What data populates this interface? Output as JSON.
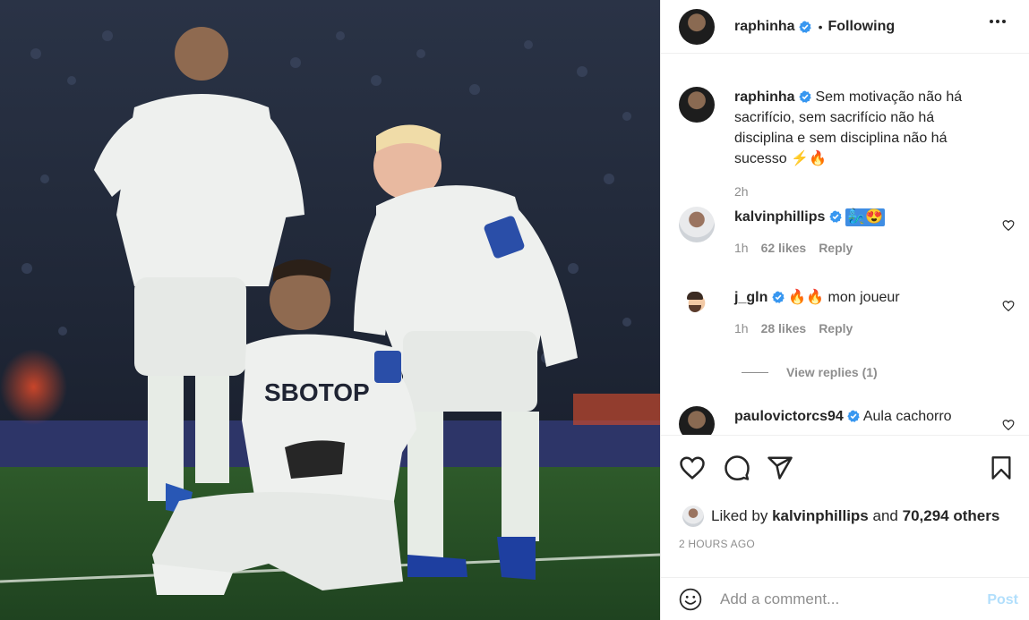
{
  "post": {
    "author": "raphinha",
    "follow_status": "Following",
    "separator": "•",
    "caption": "Sem motivação não há sacrifício, sem sacrifício não há disciplina e sem disciplina não há sucesso",
    "caption_emojis": "⚡🔥",
    "caption_time": "2h",
    "likes_prefix": "Liked by",
    "liked_by_user": "kalvinphillips",
    "likes_and": "and",
    "likes_others": "70,294 others",
    "posted_ago": "2 HOURS AGO",
    "photo_jersey_text": "SBOTOP"
  },
  "comments": [
    {
      "username": "kalvinphillips",
      "text": "",
      "emojis": "🧞‍♂️😍",
      "time": "1h",
      "likes": "62 likes",
      "reply": "Reply"
    },
    {
      "username": "j_gln",
      "text": "mon joueur",
      "emojis": "🔥🔥",
      "time": "1h",
      "likes": "28 likes",
      "reply": "Reply"
    },
    {
      "username": "paulovictorcs94",
      "text": "Aula cachorro"
    }
  ],
  "view_replies": "View replies (1)",
  "add_comment": {
    "placeholder": "Add a comment...",
    "post_label": "Post"
  },
  "icons": {
    "more": "more-options-icon",
    "like": "heart-icon",
    "comment": "comment-icon",
    "share": "share-icon",
    "save": "bookmark-icon",
    "emoji": "emoji-icon",
    "verified": "verified-badge-icon"
  },
  "colors": {
    "verified": "#3897f0",
    "post_button": "#b2dffc",
    "meta": "#8e8e8e",
    "text": "#262626"
  }
}
